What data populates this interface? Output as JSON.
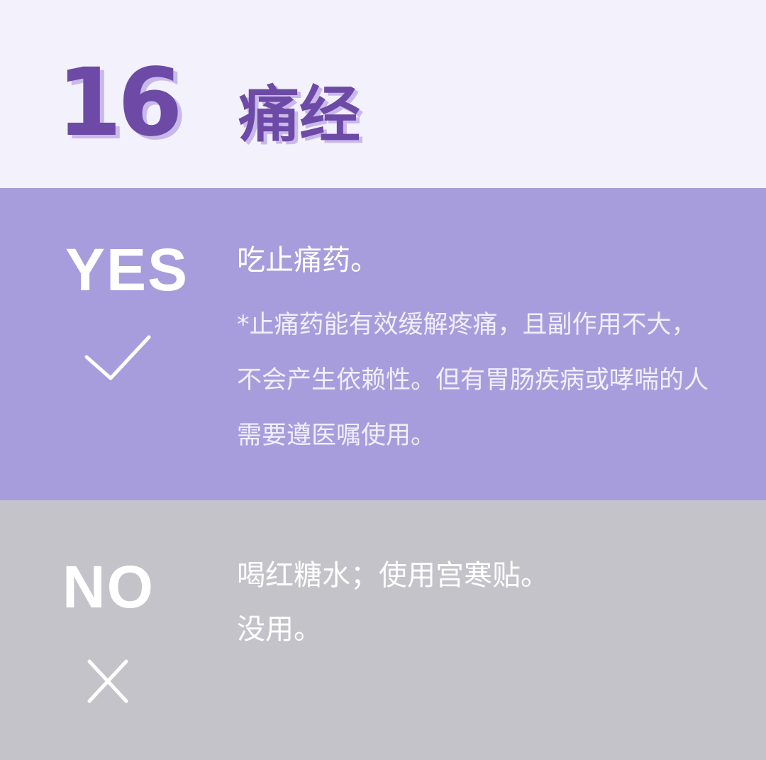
{
  "header": {
    "number": "16",
    "title": "痛经"
  },
  "yes": {
    "label": "YES",
    "icon": "check-icon",
    "main": "吃止痛药。",
    "note": "*止痛药能有效缓解疼痛，且副作用不大，不会产生依赖性。但有胃肠疾病或哮喘的人需要遵医嘱使用。"
  },
  "no": {
    "label": "NO",
    "icon": "cross-icon",
    "main": "喝红糖水；使用宫寒贴。",
    "sub": "没用。"
  },
  "colors": {
    "header_bg": "#f3f1fb",
    "accent": "#6d4aa6",
    "accent_shadow": "#c9b9ea",
    "yes_bg": "#a89ddc",
    "no_bg": "#c4c3c9",
    "text": "#ffffff"
  }
}
